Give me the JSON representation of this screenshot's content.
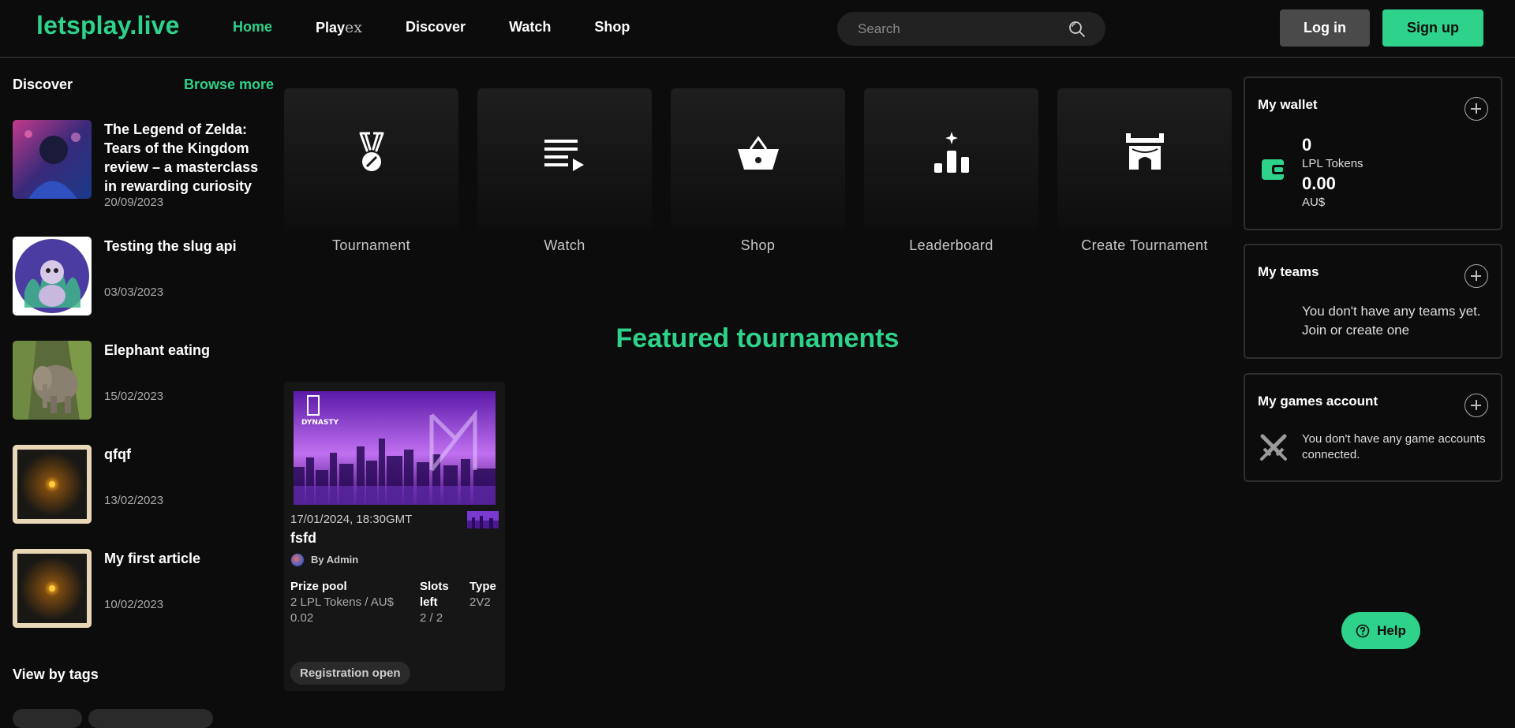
{
  "header": {
    "logo": "letsplay.live",
    "nav": {
      "home": "Home",
      "play": "Play",
      "play_suffix": "ex",
      "discover": "Discover",
      "watch": "Watch",
      "shop": "Shop"
    },
    "search_placeholder": "Search",
    "login": "Log in",
    "signup": "Sign up"
  },
  "sidebar": {
    "title": "Discover",
    "browse_more": "Browse more",
    "articles": [
      {
        "title": "The Legend of Zelda: Tears of the Kingdom review – a masterclass in rewarding curiosity",
        "date": "20/09/2023"
      },
      {
        "title": "Testing the slug api",
        "date": "03/03/2023"
      },
      {
        "title": "Elephant eating",
        "date": "15/02/2023"
      },
      {
        "title": "qfqf",
        "date": "13/02/2023"
      },
      {
        "title": "My first article",
        "date": "10/02/2023"
      }
    ],
    "tags_title": "View by tags"
  },
  "quick_links": [
    {
      "label": "Tournament",
      "icon": "medal-icon"
    },
    {
      "label": "Watch",
      "icon": "playlist-icon"
    },
    {
      "label": "Shop",
      "icon": "basket-icon"
    },
    {
      "label": "Leaderboard",
      "icon": "leaderboard-icon"
    },
    {
      "label": "Create Tournament",
      "icon": "arena-icon"
    }
  ],
  "featured": {
    "title": "Featured tournaments",
    "cards": [
      {
        "datetime": "17/01/2024, 18:30GMT",
        "name": "fsfd",
        "by": "By Admin",
        "prize_label": "Prize pool",
        "prize_value": "2 LPL Tokens / AU$ 0.02",
        "slots_label": "Slots left",
        "slots_value": "2 / 2",
        "type_label": "Type",
        "type_value": "2V2",
        "status": "Registration open"
      }
    ]
  },
  "wallet": {
    "title": "My wallet",
    "tokens": "0",
    "tokens_label": "LPL Tokens",
    "aud": "0.00",
    "aud_label": "AU$"
  },
  "teams": {
    "title": "My teams",
    "empty": "You don't have any teams yet. Join or create one"
  },
  "games": {
    "title": "My games account",
    "empty": "You don't have any game accounts connected."
  },
  "help": "Help",
  "colors": {
    "accent": "#2ed28a",
    "background": "#0c0c0c"
  }
}
